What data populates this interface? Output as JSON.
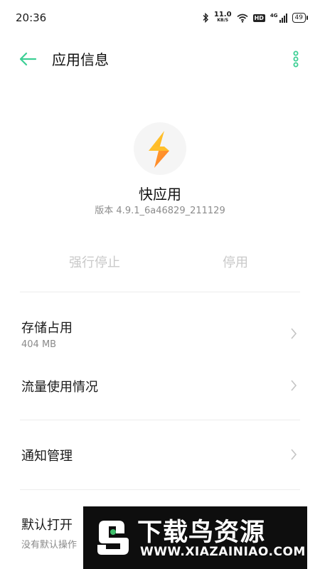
{
  "status_bar": {
    "time": "20:36",
    "net_speed_value": "11.0",
    "net_speed_unit": "KB/S",
    "hd_label": "HD",
    "network_type": "4G",
    "battery": "49"
  },
  "header": {
    "title": "应用信息",
    "accent_color": "#3ccf94"
  },
  "app": {
    "name": "快应用",
    "version": "版本 4.9.1_6a46829_211129",
    "icon": "lightning-bolt-icon"
  },
  "actions": {
    "force_stop": "强行停止",
    "disable": "停用"
  },
  "settings": {
    "storage": {
      "label": "存储占用",
      "value": "404 MB"
    },
    "data_usage": {
      "label": "流量使用情况"
    },
    "notifications": {
      "label": "通知管理"
    },
    "default_open": {
      "label": "默认打开",
      "sub": "没有默认操作"
    }
  },
  "watermark": {
    "title": "下载鸟资源",
    "url": "WWW.XIAZAINIAO.COM"
  }
}
